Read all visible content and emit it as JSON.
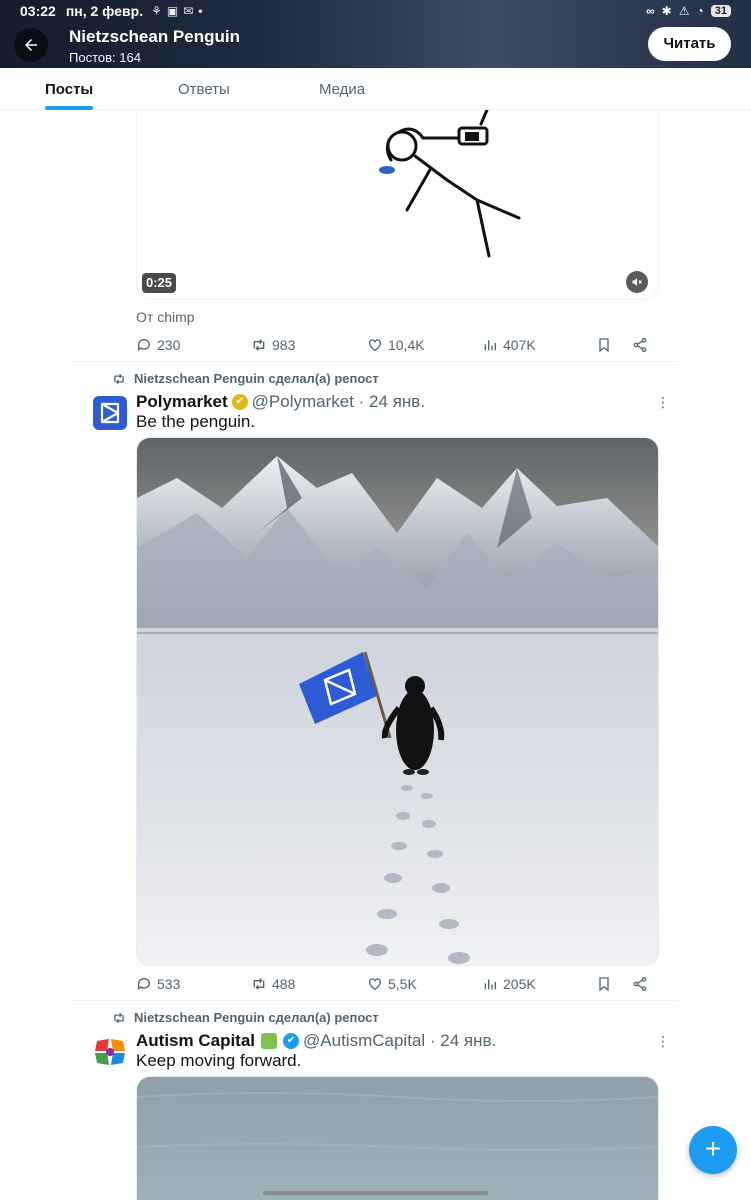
{
  "status_bar": {
    "time": "03:22",
    "date": "пн, 2 февр.",
    "mini_icons": [
      "⚘",
      "▣",
      "✉"
    ],
    "battery": "31",
    "right_icons": [
      "∞",
      "✱",
      "⚠",
      "◔"
    ]
  },
  "header": {
    "profile_name": "Nietzschean Penguin",
    "post_count": "Постов: 164",
    "follow_label": "Читать",
    "back_icon": "arrow-left-icon"
  },
  "tabs": {
    "posts": "Посты",
    "replies": "Ответы",
    "media": "Медиа"
  },
  "video_post": {
    "duration": "0:25",
    "source": "От chimp",
    "stats": {
      "replies": "230",
      "reposts": "983",
      "likes": "10,4K",
      "views": "407K"
    }
  },
  "tweets": [
    {
      "repost_label": "Nietzschean Penguin сделал(а) репост",
      "author": "Polymarket",
      "badge": "✔",
      "handle": "@Polymarket · 24 янв.",
      "text": "Be the penguin.",
      "stats": {
        "replies": "533",
        "reposts": "488",
        "likes": "5,5K",
        "views": "205K"
      }
    },
    {
      "repost_label": "Nietzschean Penguin сделал(а) репост",
      "author": "Autism Capital",
      "badge": "✔",
      "handle": "@AutismCapital · 24 янв.",
      "text": "Keep moving forward."
    }
  ],
  "fab_label": "+",
  "colors": {
    "accent": "#1d9bf0",
    "polymarket_blue": "#2d5bd6",
    "gold_badge": "#e2b719",
    "text_secondary": "#536471"
  }
}
